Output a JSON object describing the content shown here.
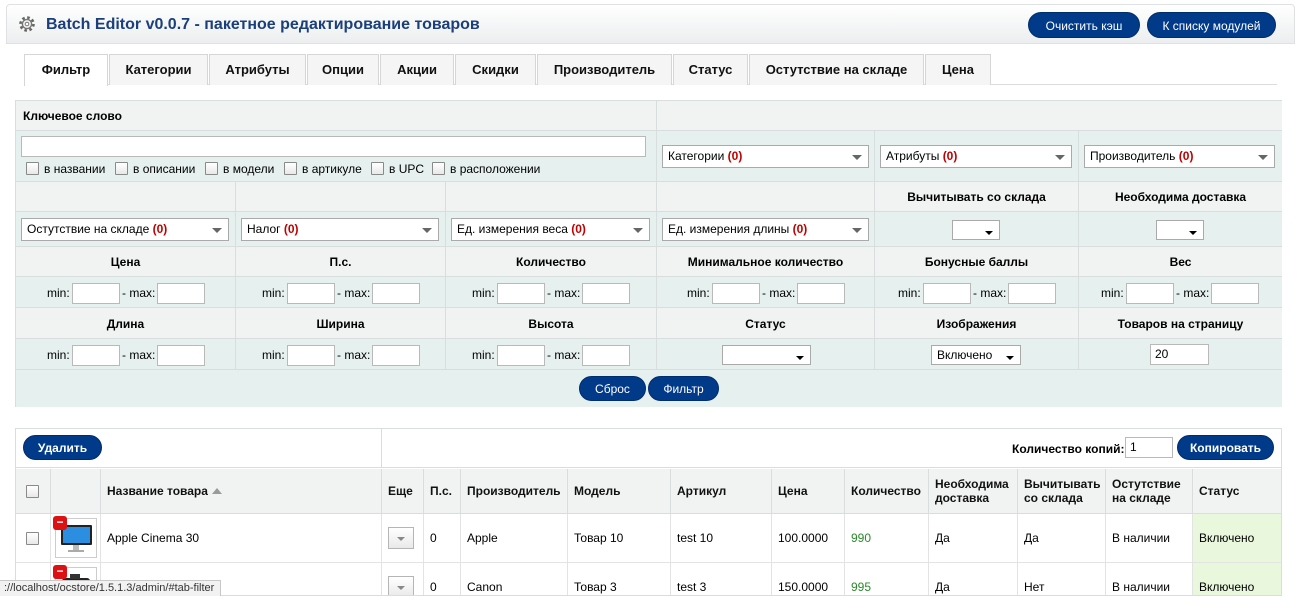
{
  "header": {
    "title": "Batch Editor v0.0.7 - пакетное редактирование товаров",
    "clear_cache": "Очистить кэш",
    "to_modules": "К списку модулей",
    "gear_icon": "gear-icon"
  },
  "tabs": [
    "Фильтр",
    "Категории",
    "Атрибуты",
    "Опции",
    "Акции",
    "Скидки",
    "Производитель",
    "Статус",
    "Остутствие на складе",
    "Цена"
  ],
  "filter": {
    "keyword_label": "Ключевое слово",
    "keyword_value": "",
    "checks": [
      "в названии",
      "в описании",
      "в модели",
      "в артикуле",
      "в UPC",
      "в расположении"
    ],
    "sel_categories": "Категории",
    "sel_attributes": "Атрибуты",
    "sel_manufacturer": "Производитель",
    "sel_stock": "Остутствие на складе",
    "sel_tax": "Налог",
    "sel_weight_unit": "Ед. измерения веса",
    "sel_length_unit": "Ед. измерения длины",
    "count": "(0)",
    "subtract_label": "Вычитывать со склада",
    "shipping_label": "Необходима доставка",
    "price": "Цена",
    "ps": "П.с.",
    "quantity": "Количество",
    "min_quantity": "Минимальное количество",
    "bonus": "Бонусные баллы",
    "weight": "Вес",
    "length": "Длина",
    "width": "Ширина",
    "height": "Высота",
    "status": "Статус",
    "images": "Изображения",
    "per_page": "Товаров на страницу",
    "min": "min:",
    "max": "- max:",
    "images_value": "Включено",
    "per_page_value": "20",
    "reset": "Сброс",
    "apply": "Фильтр"
  },
  "products": {
    "delete": "Удалить",
    "copies_label": "Количество копий:",
    "copies_value": "1",
    "copy": "Копировать",
    "columns": [
      "Название товара",
      "Еще",
      "П.с.",
      "Производитель",
      "Модель",
      "Артикул",
      "Цена",
      "Количество",
      "Необходима доставка",
      "Вычитывать со склада",
      "Остутствие на складе",
      "Статус"
    ],
    "sort_icon": "sort-asc-icon",
    "rows": [
      {
        "name": "Apple Cinema 30",
        "ps": "0",
        "manufacturer": "Apple",
        "model": "Товар 10",
        "sku": "test 10",
        "price": "100.0000",
        "qty": "990",
        "shipping": "Да",
        "subtract": "Да",
        "stock": "В наличии",
        "status": "Включено"
      },
      {
        "name": "",
        "ps": "0",
        "manufacturer": "Canon",
        "model": "Товар 3",
        "sku": "test 3",
        "price": "150.0000",
        "qty": "995",
        "shipping": "Да",
        "subtract": "Нет",
        "stock": "В наличии",
        "status": "Включено"
      }
    ]
  },
  "statusbar": "://localhost/ocstore/1.5.1.3/admin/#tab-filter"
}
